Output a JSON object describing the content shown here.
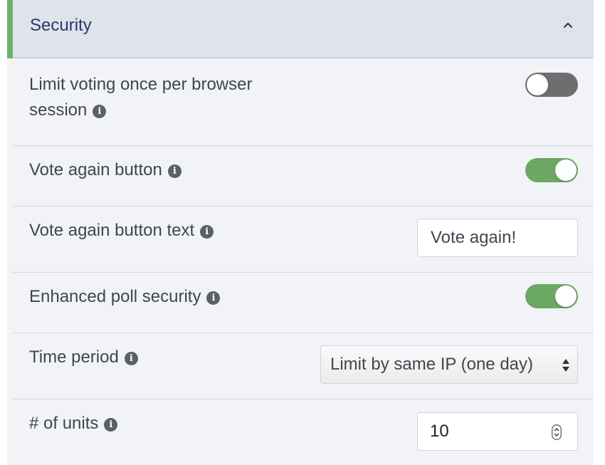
{
  "section": {
    "title": "Security",
    "expanded": true,
    "accent_color": "#6cb26a"
  },
  "settings": {
    "limit_voting": {
      "label_line1": "Limit voting once per browser",
      "label_line2": "session",
      "info": "i",
      "enabled": false
    },
    "vote_again": {
      "label": "Vote again button",
      "info": "i",
      "enabled": true
    },
    "vote_again_text": {
      "label": "Vote again button text",
      "info": "i",
      "value": "Vote again!"
    },
    "enhanced_security": {
      "label": "Enhanced poll security",
      "info": "i",
      "enabled": true
    },
    "time_period": {
      "label": "Time period",
      "info": "i",
      "selected": "Limit by same IP (one day)"
    },
    "units": {
      "label": "# of units",
      "info": "i",
      "value": "10"
    }
  },
  "colors": {
    "toggle_on": "#6aa864",
    "toggle_off": "#6d6e70",
    "header_bg": "#dfe3ec",
    "panel_bg": "#f2f3f6"
  }
}
